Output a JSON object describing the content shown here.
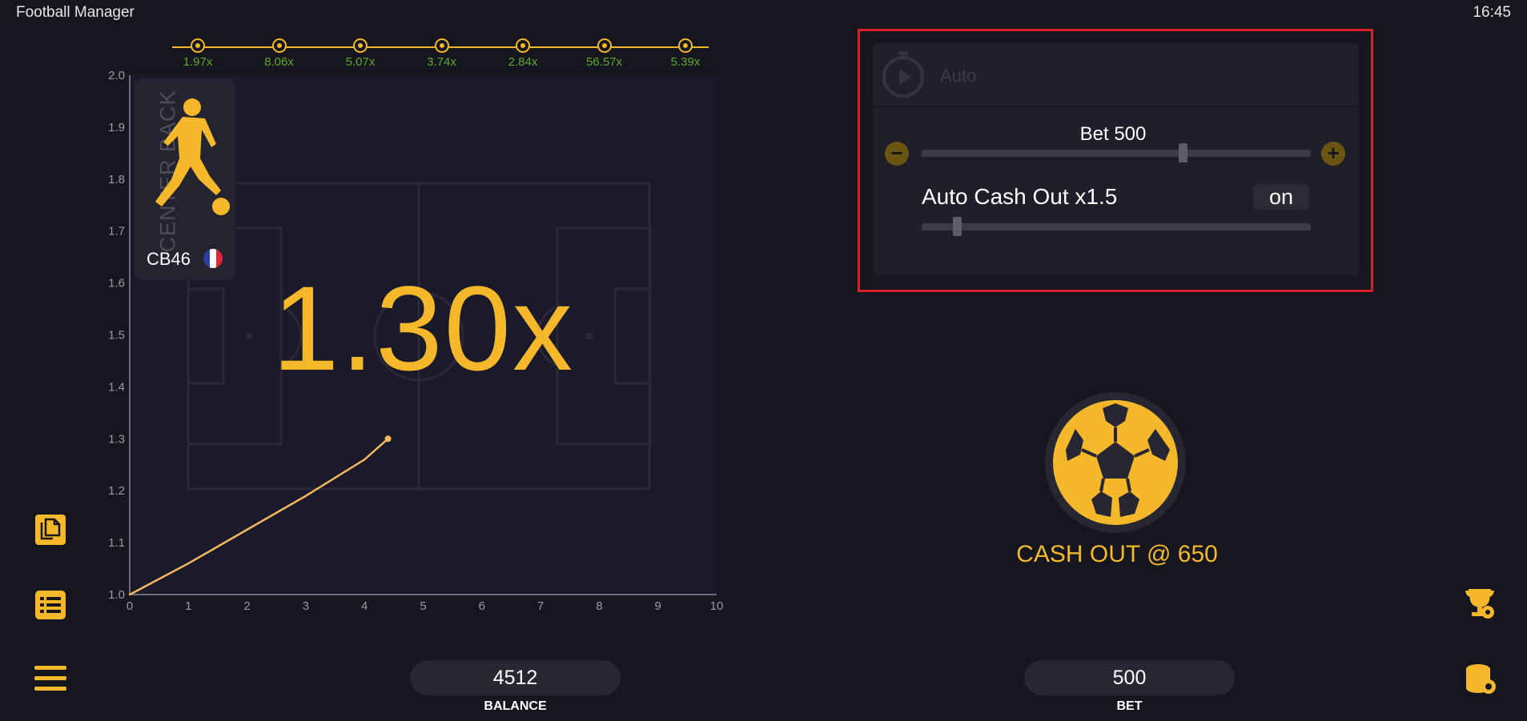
{
  "app": {
    "title": "Football Manager",
    "clock": "16:45"
  },
  "colors": {
    "accent": "#f4b82a",
    "history_text": "#5fa82a",
    "highlight": "#d72027",
    "background": "#16161f"
  },
  "history": [
    "1.97x",
    "8.06x",
    "5.07x",
    "3.74x",
    "2.84x",
    "56.57x",
    "5.39x"
  ],
  "player": {
    "position": "CENTER BACK",
    "name": "CB46",
    "flag": "france-flag"
  },
  "multiplier": "1.30x",
  "chart_data": {
    "type": "line",
    "xlim": [
      0,
      10
    ],
    "ylim": [
      1.0,
      2.0
    ],
    "x_ticks": [
      "0",
      "1",
      "2",
      "3",
      "4",
      "5",
      "6",
      "7",
      "8",
      "9",
      "10"
    ],
    "y_ticks": [
      "1.0",
      "1.1",
      "1.2",
      "1.3",
      "1.4",
      "1.5",
      "1.6",
      "1.7",
      "1.8",
      "1.9",
      "2.0"
    ],
    "series": [
      {
        "x": [
          0,
          1,
          2,
          3,
          4,
          4.4
        ],
        "y": [
          1.0,
          1.06,
          1.125,
          1.19,
          1.26,
          1.3
        ]
      }
    ]
  },
  "auto_panel": {
    "header_label": "Auto",
    "bet_label": "Bet 500",
    "bet_slider_fraction": 0.67,
    "cashout_label": "Auto Cash Out x1.5",
    "cashout_slider_fraction": 0.09,
    "toggle_label": "on",
    "minus": "−",
    "plus": "+"
  },
  "cashout_button": {
    "label": "CASH OUT @ 650"
  },
  "footer": {
    "balance_value": "4512",
    "balance_label": "BALANCE",
    "bet_value": "500",
    "bet_label": "BET"
  },
  "icons": {
    "left": [
      "copy-icon",
      "list-icon",
      "menu-icon"
    ],
    "right": [
      "trophy-icon",
      "coins-icon"
    ]
  }
}
